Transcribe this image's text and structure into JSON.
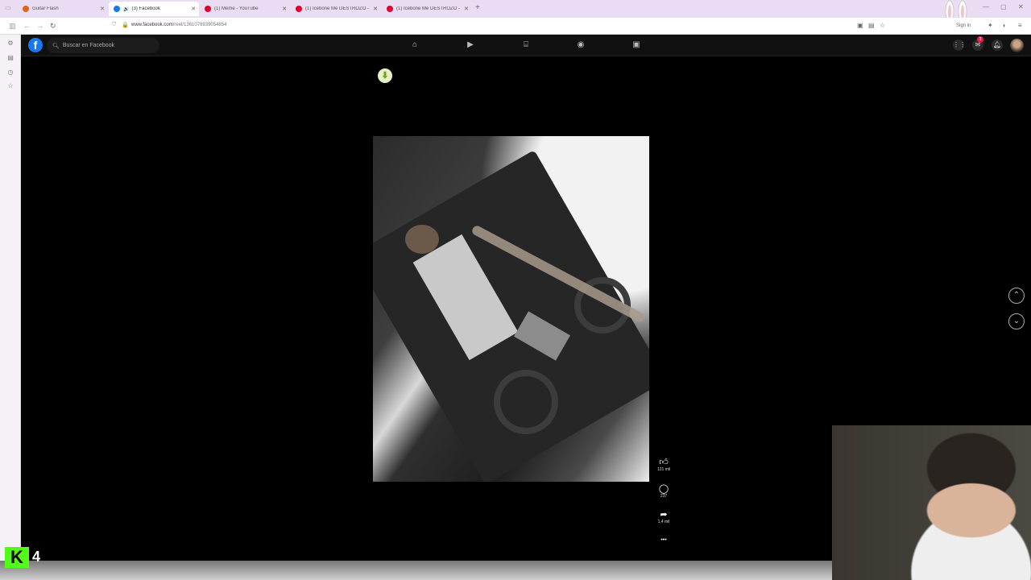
{
  "browser": {
    "tabs": [
      {
        "label": "Guitar Flash",
        "color": "#e0651b"
      },
      {
        "label": "(3) Facebook",
        "color": "#1877f2",
        "active": true
      },
      {
        "label": "(1) Meme - YouTube",
        "color": "#e1002d"
      },
      {
        "label": "(1) Icebone Me DESTROZO - YouTube",
        "color": "#e1002d"
      },
      {
        "label": "(1) Icebone Me DESTROZO - YouTube",
        "color": "#e1002d"
      }
    ],
    "new_tab": "+",
    "url_host": "www.facebook.com",
    "url_path": "/reel/1361076939054854",
    "sign_in": "Sign in"
  },
  "facebook": {
    "logo": "f",
    "search_placeholder": "Buscar en Facebook",
    "nav_icons": [
      "home-icon",
      "video-icon",
      "marketplace-icon",
      "groups-icon",
      "gaming-icon"
    ],
    "notification_count": "3"
  },
  "reel": {
    "likes": "121 mil",
    "comments": "237",
    "shares": "1,4 mil",
    "more": "•••"
  },
  "overlay": {
    "kick_logo": "K",
    "kick_count": "4"
  }
}
